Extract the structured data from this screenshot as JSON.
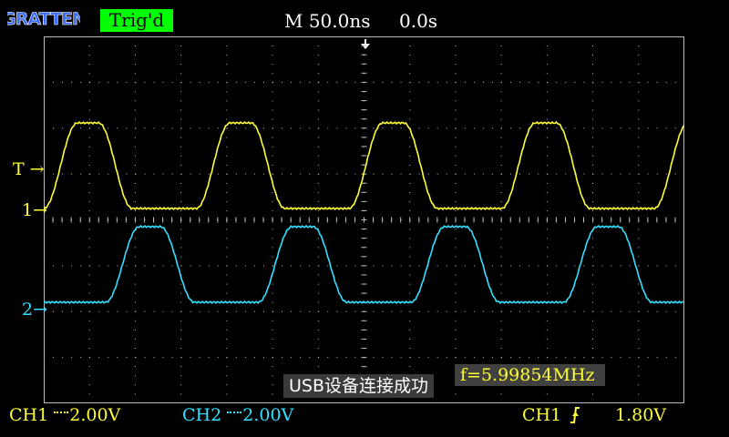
{
  "brand": {
    "logo_text": "GRATTEN",
    "logo_color": "#3a6cff"
  },
  "header": {
    "trigger_status": "Trig'd",
    "timebase": "M 50.0ns",
    "horizontal_position": "0.0s",
    "trigger_position_icon": "down-arrow-icon"
  },
  "markers": {
    "trigger_level": "T →",
    "ch1": "1→",
    "ch2": "2→"
  },
  "colors": {
    "ch1": "#ffff33",
    "ch2": "#33e0ff",
    "grid": "#bbbbbb",
    "background": "#000000",
    "trigger_badge": "#00ff00"
  },
  "toast": {
    "message": "USB设备连接成功"
  },
  "measurement": {
    "frequency": "f=5.99854MHz"
  },
  "status": {
    "ch1_scale": "2.00V",
    "ch1_label": "CH1",
    "ch2_scale": "2.00V",
    "ch2_label": "CH2",
    "trigger_source": "CH1",
    "trigger_edge_icon": "rising-edge-icon",
    "trigger_level": "1.80V"
  }
}
